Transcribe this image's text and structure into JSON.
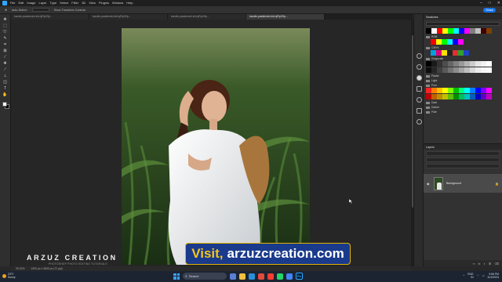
{
  "menubar": {
    "items": [
      "File",
      "Edit",
      "Image",
      "Layer",
      "Type",
      "Select",
      "Filter",
      "3D",
      "View",
      "Plugins",
      "Window",
      "Help"
    ]
  },
  "options": {
    "auto_select": "Auto-Select:",
    "layer": "Layer",
    "show_transform": "Show Transform Controls",
    "share": "Share"
  },
  "tabs": [
    {
      "label": "karolin-pastemaki-lmUyRp2Hp..."
    },
    {
      "label": "karolin-pastemaki-lmUyRp2Hp..."
    },
    {
      "label": "karolin-pastemaki-lmUyRp2Hp..."
    },
    {
      "label": "karolin-pastemaki-lmUyRp2Hp..."
    }
  ],
  "swatches": {
    "title": "Swatches",
    "groups": [
      "RGB",
      "CMYK",
      "Grayscale",
      "Pastel",
      "Light",
      "Pure",
      "Dark",
      "Darker",
      "Pale"
    ],
    "row1": [
      "#000000",
      "#ffffff",
      "#ff0000",
      "#ffff00",
      "#00ff00",
      "#00ffff",
      "#0000ff",
      "#ff00ff",
      "#808080",
      "#c0c0c0",
      "#400000",
      "#804000"
    ],
    "rgb": [
      "#ff0000",
      "#ffff00",
      "#00ff00",
      "#00ffff",
      "#0000ff",
      "#ff00ff"
    ],
    "cmyk": [
      "#00a0e0",
      "#e0007a",
      "#ffe000",
      "#222222",
      "#e03030",
      "#30a030",
      "#2040c0"
    ],
    "gray1": [
      "#000000",
      "#1a1a1a",
      "#333333",
      "#4d4d4d",
      "#666666",
      "#808080",
      "#999999",
      "#b3b3b3",
      "#cccccc",
      "#e6e6e6",
      "#f2f2f2",
      "#ffffff"
    ],
    "gray2": [
      "#0d0d0d",
      "#262626",
      "#404040",
      "#595959",
      "#737373",
      "#8c8c8c",
      "#a6a6a6",
      "#bfbfbf",
      "#d9d9d9",
      "#ececec",
      "#f7f7f7",
      "#fafafa"
    ],
    "pure1": [
      "#ff2020",
      "#ff8000",
      "#ffc000",
      "#ffff00",
      "#80ff00",
      "#00c000",
      "#00ff80",
      "#00ffff",
      "#0080ff",
      "#0000ff",
      "#8000ff",
      "#ff00ff"
    ],
    "pure2": [
      "#c00000",
      "#c06000",
      "#c09000",
      "#c0c000",
      "#60c000",
      "#009000",
      "#00c060",
      "#00c0c0",
      "#0060c0",
      "#0000c0",
      "#6000c0",
      "#c000c0"
    ]
  },
  "layers": {
    "title": "Layers",
    "layer_name": "Background"
  },
  "status": {
    "zoom": "25.22%",
    "info": "1920 px x 3840 px (72 ppi)"
  },
  "watermark": {
    "title": "ARZUZ CREATION",
    "subtitle": "PHOTOSHOP PHOTO EDITING TUTORIALS"
  },
  "banner": {
    "visit": "Visit,",
    "site": "arzuzcreation.com"
  },
  "taskbar": {
    "weather_temp": "23°C",
    "weather_desc": "Sunny",
    "search": "Search",
    "ps": "Ps",
    "lang": "ENG",
    "region": "IN",
    "time": "9:56 PM",
    "date": "11/4/2024"
  },
  "colors": {
    "accent": "#31a8ff",
    "banner_bg": "#1a3a8c",
    "banner_border": "#e2b400",
    "banner_visit": "#f5c518"
  }
}
